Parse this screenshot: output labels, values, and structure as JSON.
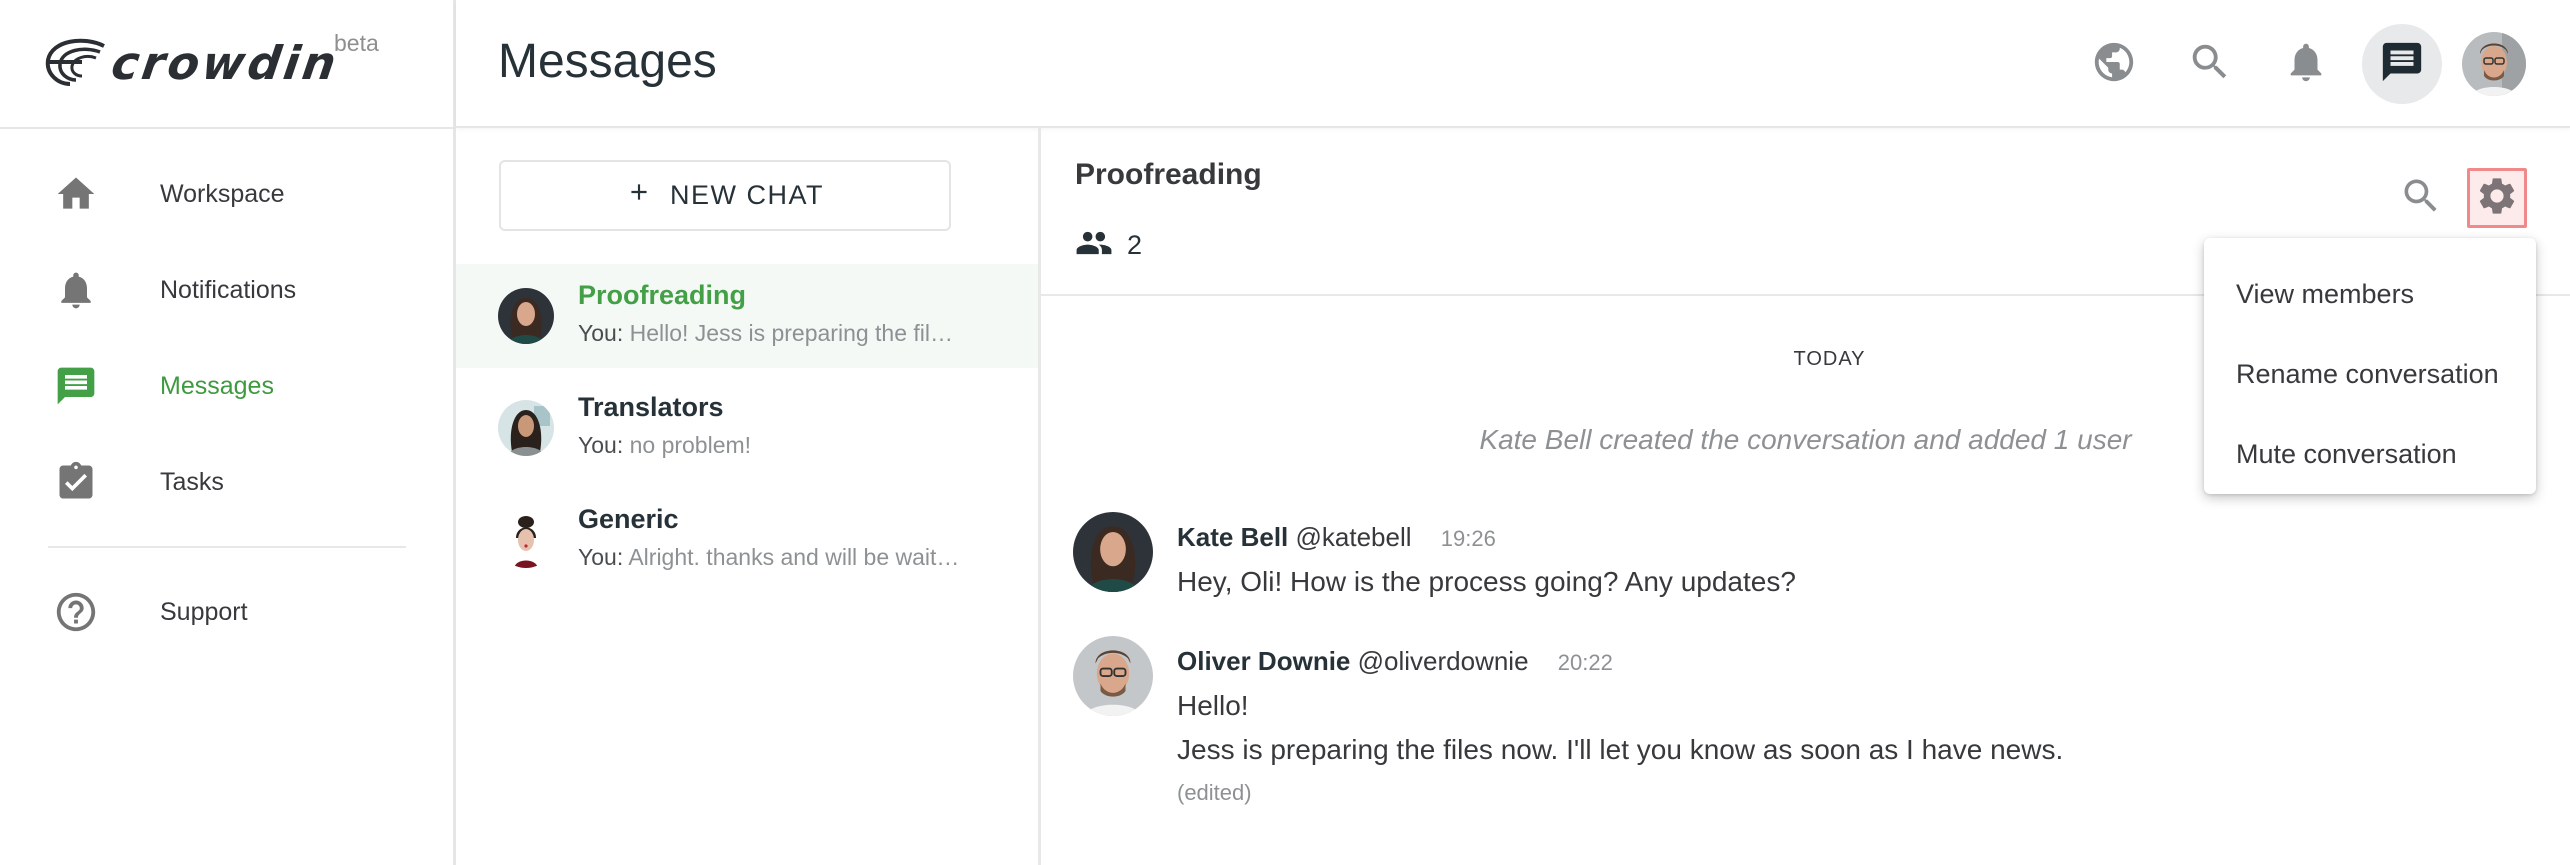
{
  "brand": {
    "name": "crowdin",
    "badge": "beta"
  },
  "colors": {
    "accent": "#43a047",
    "text": "#263238",
    "muted": "#8e9193",
    "highlight_border": "#f08a8a",
    "highlight_bg": "#fdeaea",
    "active_row": "#f5f9f6"
  },
  "sidebar": {
    "items": [
      {
        "label": "Workspace",
        "icon": "home-icon",
        "active": false
      },
      {
        "label": "Notifications",
        "icon": "bell-icon",
        "active": false
      },
      {
        "label": "Messages",
        "icon": "chat-icon",
        "active": true
      },
      {
        "label": "Tasks",
        "icon": "clipboard-check-icon",
        "active": false
      }
    ],
    "footer_items": [
      {
        "label": "Support",
        "icon": "help-circle-icon"
      }
    ]
  },
  "header": {
    "title": "Messages",
    "icons": [
      "globe-icon",
      "search-icon",
      "bell-icon",
      "chat-icon",
      "user-avatar"
    ]
  },
  "chat_list": {
    "new_chat_label": "NEW CHAT",
    "items": [
      {
        "name": "Proofreading",
        "prefix": "You:",
        "preview": "Hello! Jess is preparing the fil…",
        "active": true
      },
      {
        "name": "Translators",
        "prefix": "You:",
        "preview": "no problem!",
        "active": false
      },
      {
        "name": "Generic",
        "prefix": "You:",
        "preview": "Alright. thanks and will be wait…",
        "active": false
      }
    ]
  },
  "conversation": {
    "title": "Proofreading",
    "member_count": "2",
    "day_label": "TODAY",
    "system_message": "Kate Bell created the conversation and added 1 user",
    "messages": [
      {
        "author": "Kate Bell",
        "handle": "@katebell",
        "time": "19:26",
        "lines": [
          "Hey, Oli! How is the process going? Any updates?"
        ],
        "edited": ""
      },
      {
        "author": "Oliver Downie",
        "handle": "@oliverdownie",
        "time": "20:22",
        "lines": [
          "Hello!",
          "Jess is preparing the files now. I'll let you know as soon as I have news."
        ],
        "edited": "(edited)"
      }
    ]
  },
  "settings_menu": {
    "items": [
      "View members",
      "Rename conversation",
      "Mute conversation"
    ]
  }
}
